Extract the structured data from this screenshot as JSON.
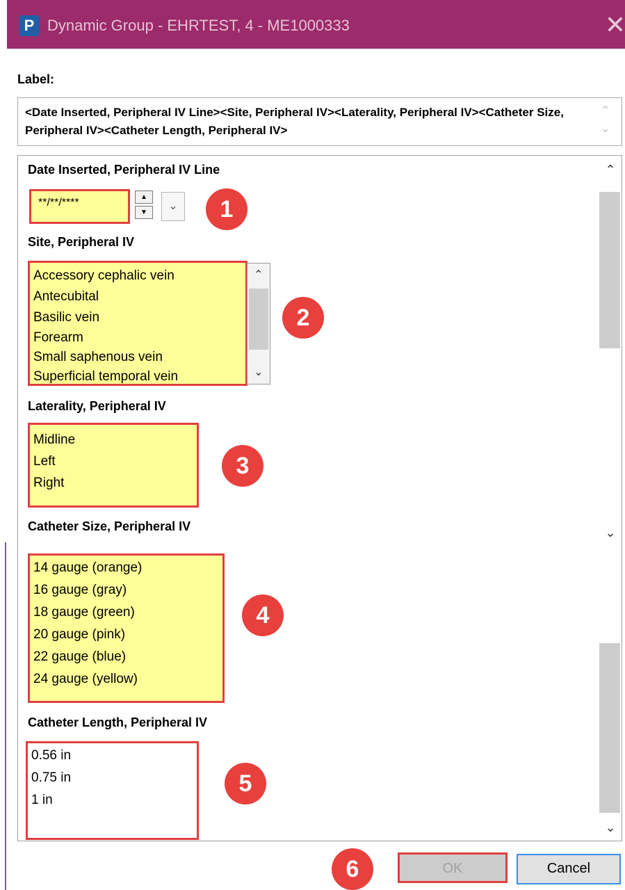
{
  "window": {
    "app_icon_letter": "P",
    "title": "Dynamic Group - EHRTEST, 4 - ME1000333",
    "close_glyph": "✕"
  },
  "label": {
    "heading": "Label:",
    "text": "<Date Inserted, Peripheral IV Line><Site, Peripheral IV><Laterality, Peripheral IV><Catheter Size, Peripheral IV><Catheter Length, Peripheral IV>"
  },
  "sections": {
    "date_inserted": {
      "title": "Date Inserted, Peripheral IV Line",
      "value": "**/**/****"
    },
    "site": {
      "title": "Site, Peripheral IV",
      "items": [
        "Accessory cephalic vein",
        "Antecubital",
        "Basilic vein",
        "Forearm",
        "Small saphenous vein",
        "Superficial temporal vein"
      ]
    },
    "laterality": {
      "title": "Laterality, Peripheral IV",
      "items": [
        "Midline",
        "Left",
        "Right"
      ]
    },
    "catheter_size": {
      "title": "Catheter Size, Peripheral IV",
      "items": [
        "14 gauge (orange)",
        "16 gauge (gray)",
        "18 gauge (green)",
        "20 gauge (pink)",
        "22 gauge (blue)",
        "24 gauge (yellow)"
      ]
    },
    "catheter_length": {
      "title": "Catheter Length, Peripheral IV",
      "items": [
        "0.56 in",
        "0.75 in",
        "1 in"
      ]
    }
  },
  "badges": [
    "1",
    "2",
    "3",
    "4",
    "5",
    "6"
  ],
  "buttons": {
    "ok": "OK",
    "cancel": "Cancel"
  },
  "icons": {
    "scroll_up": "chevron-up-icon",
    "scroll_down": "chevron-down-icon",
    "dropdown": "chevron-down-icon",
    "close": "close-icon",
    "app": "app-logo-icon"
  },
  "colors": {
    "titlebar": "#9b2b6a",
    "highlight_border": "#e14040",
    "field_fill": "#ffff99",
    "badge": "#e8403d",
    "focus_border": "#3b8ee8"
  }
}
